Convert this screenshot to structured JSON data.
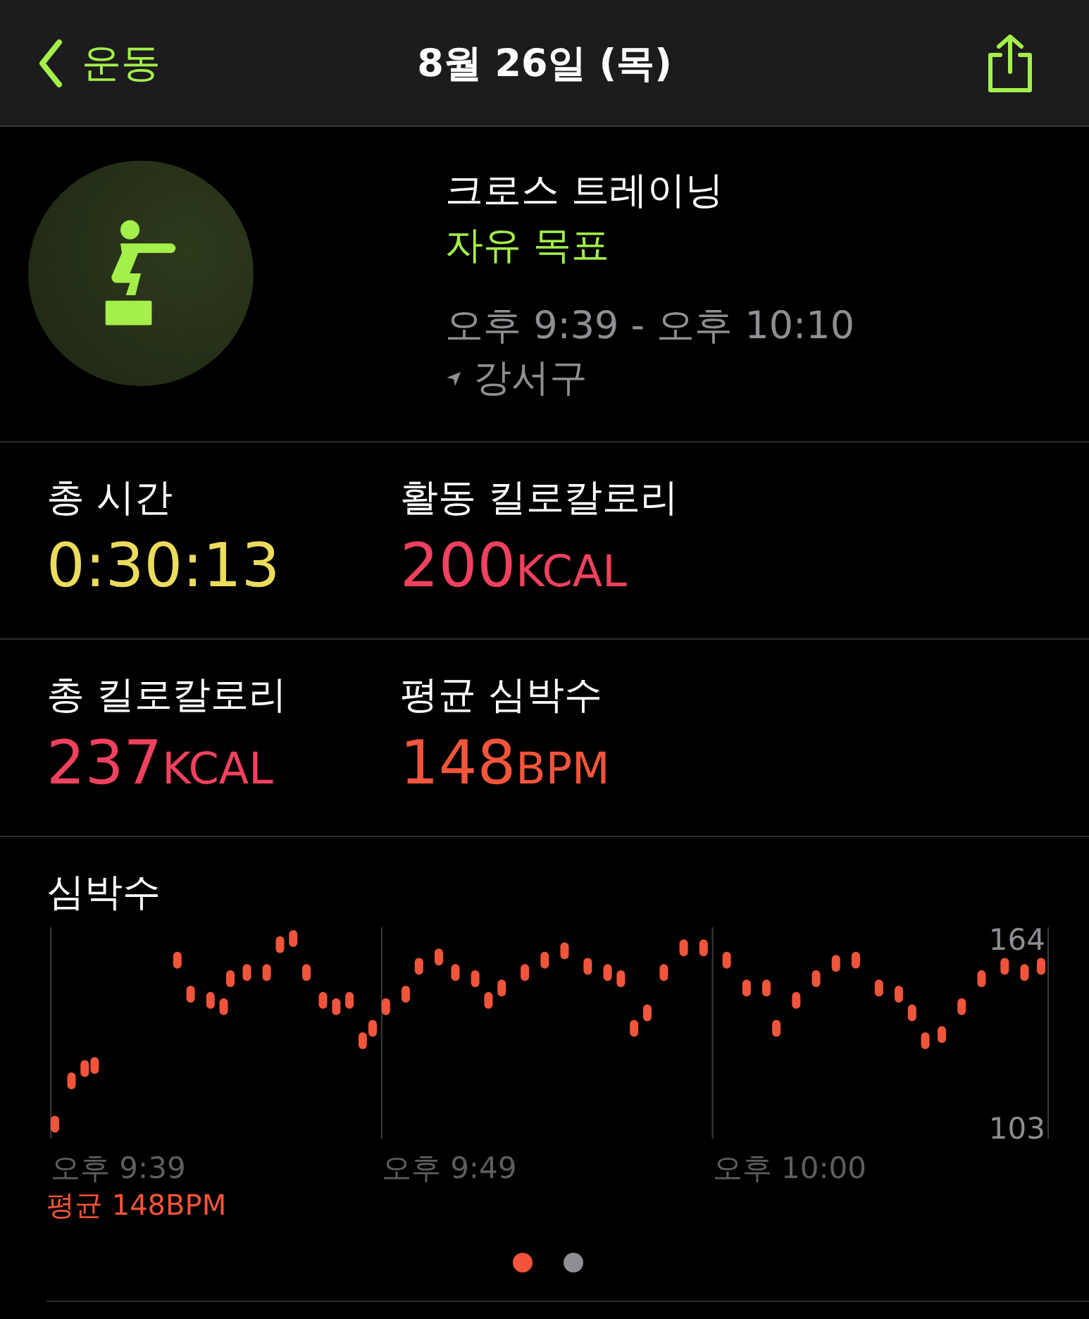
{
  "nav": {
    "back": "운동",
    "title": "8월 26일 (목)"
  },
  "workout": {
    "name": "크로스 트레이닝",
    "goal": "자유 목표",
    "time": "오후 9:39 - 오후 10:10",
    "location": "강서구"
  },
  "stats": [
    {
      "label": "총 시간",
      "value": "0:30:13",
      "color": "#ecdc5c"
    },
    {
      "label": "활동 킬로칼로리",
      "value": "200",
      "unit": "KCAL",
      "color": "#f0415e"
    },
    {
      "label": "총 킬로칼로리",
      "value": "237",
      "unit": "KCAL",
      "color": "#f0415e"
    },
    {
      "label": "평균 심박수",
      "value": "148",
      "unit": "BPM",
      "color": "#f2553b"
    }
  ],
  "heart_rate": {
    "title": "심박수",
    "axis_labels": [
      "164",
      "103"
    ],
    "time_labels": [
      "오후 9:39",
      "오후 9:49",
      "오후 10:00"
    ],
    "average": "평균 148BPM"
  },
  "pages": [
    {
      "selected": true
    },
    {
      "selected": false
    }
  ]
}
